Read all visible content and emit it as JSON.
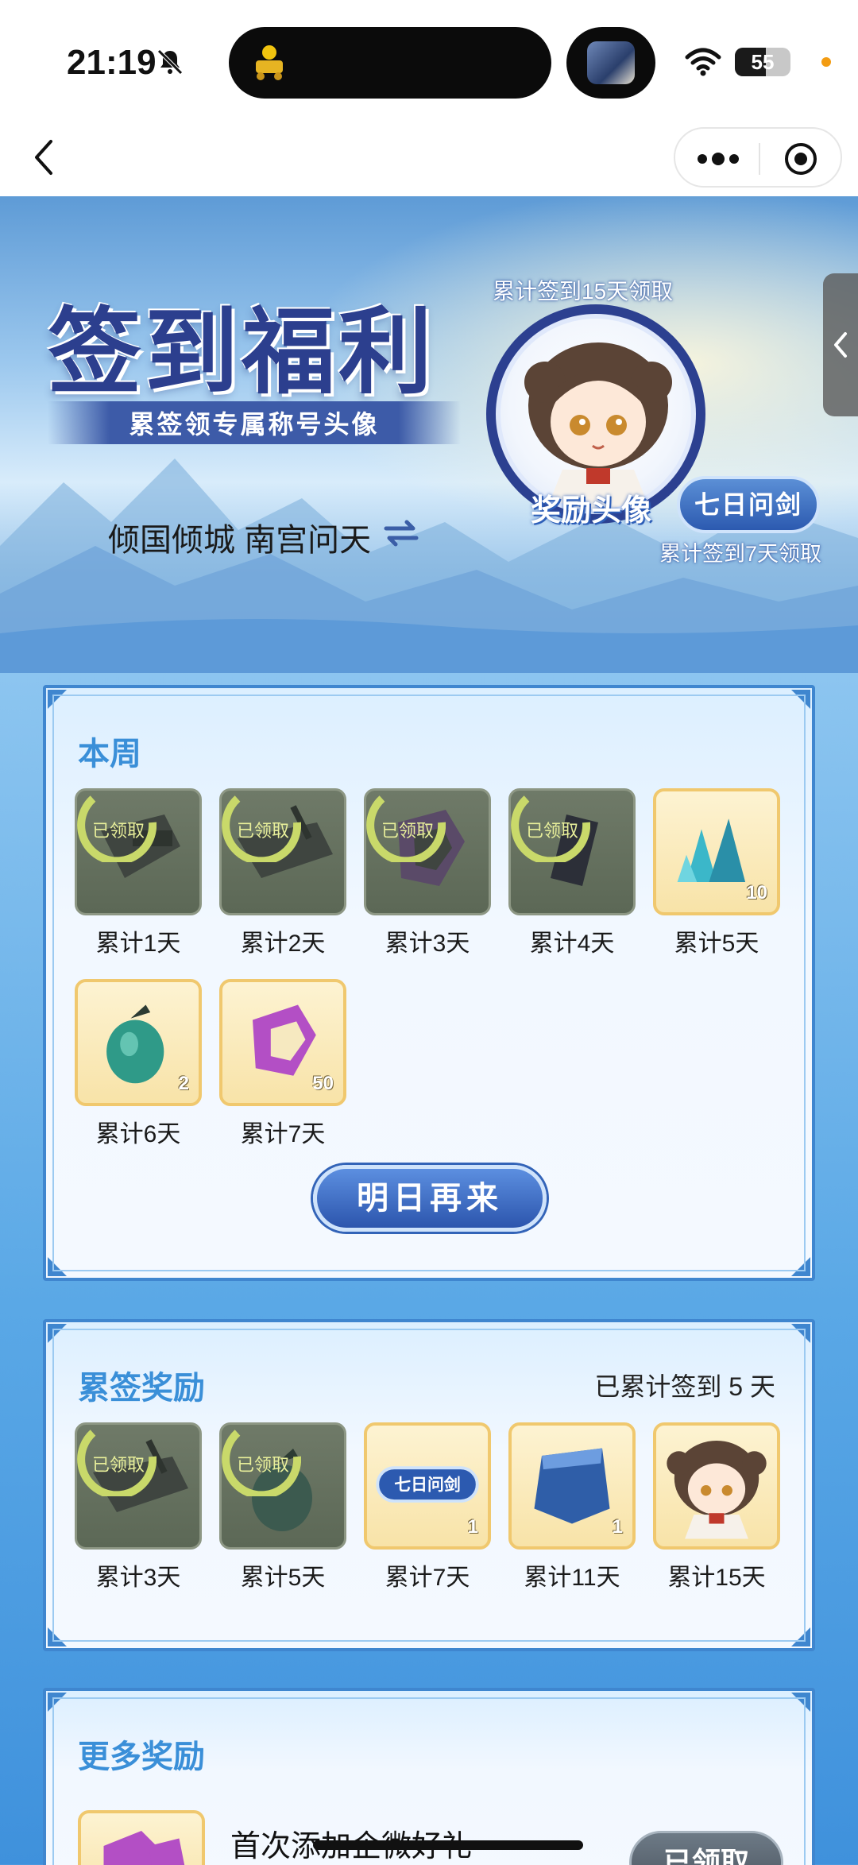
{
  "status_bar": {
    "time": "21:19",
    "battery": "55",
    "battery_level": 0.55
  },
  "icons": {
    "bell": "bell-muted-icon",
    "wifi": "wifi-icon",
    "back": "chevron-left-icon",
    "more": "more-dots-icon",
    "close_target": "target-icon",
    "swap": "swap-icon",
    "side_tab": "chevron-left-icon"
  },
  "hero": {
    "title": "签到福利",
    "subtitle": "累签领专属称号头像",
    "user_names": "倾国倾城 南宫问天",
    "avatar_caption_top": "累计签到15天领取",
    "avatar_label": "奖励头像",
    "title_badge": "七日问剑",
    "avatar_caption_bottom": "累计签到7天领取"
  },
  "weekly": {
    "title": "本周",
    "items": [
      {
        "label": "累计1天",
        "claimed": true,
        "stamp": "已领取"
      },
      {
        "label": "累计2天",
        "claimed": true,
        "stamp": "已领取"
      },
      {
        "label": "累计3天",
        "claimed": true,
        "stamp": "已领取"
      },
      {
        "label": "累计4天",
        "claimed": true,
        "stamp": "已领取"
      },
      {
        "label": "累计5天",
        "claimed": false,
        "qty": "10"
      },
      {
        "label": "累计6天",
        "claimed": false,
        "qty": "2"
      },
      {
        "label": "累计7天",
        "claimed": false,
        "qty": "50"
      }
    ],
    "button": "明日再来"
  },
  "cumulative": {
    "title": "累签奖励",
    "status": "已累计签到 5 天",
    "items": [
      {
        "label": "累计3天",
        "claimed": true,
        "stamp": "已领取"
      },
      {
        "label": "累计5天",
        "claimed": true,
        "stamp": "已领取"
      },
      {
        "label": "累计7天",
        "claimed": false,
        "badge_text": "七日问剑",
        "qty": "1"
      },
      {
        "label": "累计11天",
        "claimed": false,
        "qty": "1"
      },
      {
        "label": "累计15天",
        "claimed": false
      }
    ]
  },
  "more": {
    "title": "更多奖励",
    "row_title": "首次添加企微好礼",
    "row_button": "已领取"
  },
  "colors": {
    "accent_blue": "#3a8fd8",
    "card_border": "#3f86cf",
    "item_gold_border": "#f0c86e",
    "claimed_bg": "#6f7a68"
  }
}
